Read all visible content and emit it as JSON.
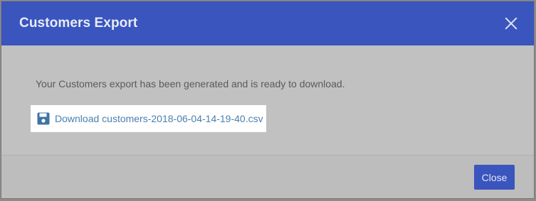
{
  "dialog": {
    "title": "Customers Export",
    "close_icon": "close-x-icon",
    "message": "Your Customers export has been generated and is ready to download.",
    "download_link": {
      "icon": "floppy-disk-icon",
      "label": "Download customers-2018-06-04-14-19-40.csv"
    },
    "footer": {
      "close_label": "Close"
    }
  },
  "colors": {
    "header_bg": "#3a55be",
    "body_bg": "#c1c1c1",
    "link": "#4a7fb0",
    "button_bg": "#3a55be"
  }
}
